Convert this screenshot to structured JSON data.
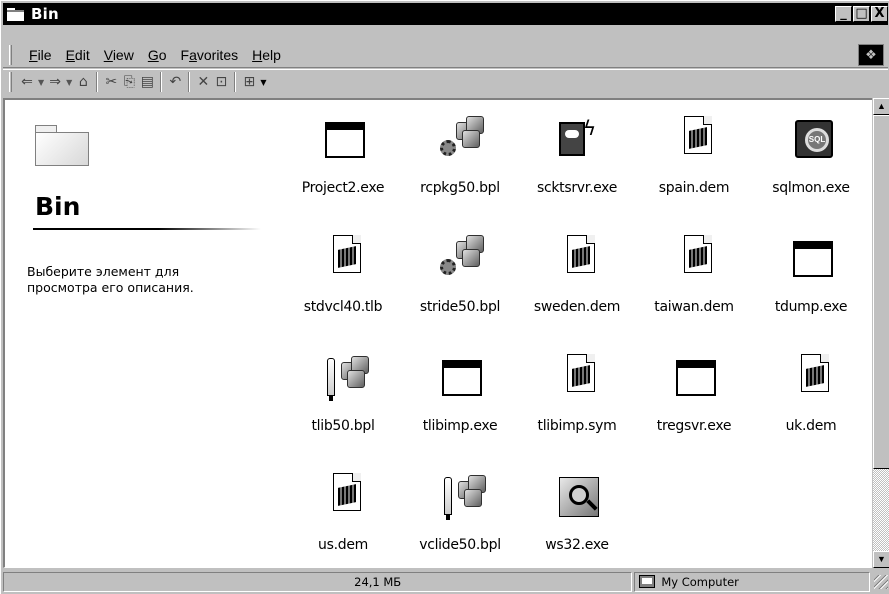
{
  "window": {
    "title": "Bin",
    "controls": {
      "minimize": "_",
      "maximize": "□",
      "close": "X"
    }
  },
  "menu": {
    "items": [
      {
        "key": "F",
        "rest": "ile"
      },
      {
        "key": "E",
        "rest": "dit"
      },
      {
        "key": "V",
        "rest": "iew"
      },
      {
        "key": "G",
        "rest": "o"
      },
      {
        "pre": "F",
        "key": "a",
        "rest": "vorites"
      },
      {
        "key": "H",
        "rest": "elp"
      }
    ]
  },
  "toolbar": {
    "buttons": [
      "back-arrow",
      "dropdown",
      "forward-arrow",
      "dropdown",
      "up-folder",
      "cut",
      "copy",
      "paste",
      "undo",
      "delete",
      "properties",
      "views",
      "dropdown"
    ]
  },
  "left_pane": {
    "title": "Bin",
    "description": "Выберите элемент для просмотра его описания."
  },
  "files": [
    {
      "name": "Project2.exe",
      "icon": "exe-window-icon"
    },
    {
      "name": "rcpkg50.bpl",
      "icon": "package-icon"
    },
    {
      "name": "scktsrvr.exe",
      "icon": "socket-server-icon"
    },
    {
      "name": "spain.dem",
      "icon": "document-icon"
    },
    {
      "name": "sqlmon.exe",
      "icon": "sql-monitor-icon"
    },
    {
      "name": "stdvcl40.tlb",
      "icon": "document-icon"
    },
    {
      "name": "stride50.bpl",
      "icon": "package-icon"
    },
    {
      "name": "sweden.dem",
      "icon": "document-icon"
    },
    {
      "name": "taiwan.dem",
      "icon": "document-icon"
    },
    {
      "name": "tdump.exe",
      "icon": "exe-window-icon"
    },
    {
      "name": "tlib50.bpl",
      "icon": "tlib-package-icon"
    },
    {
      "name": "tlibimp.exe",
      "icon": "exe-window-icon"
    },
    {
      "name": "tlibimp.sym",
      "icon": "document-icon"
    },
    {
      "name": "tregsvr.exe",
      "icon": "exe-window-icon"
    },
    {
      "name": "uk.dem",
      "icon": "document-icon"
    },
    {
      "name": "us.dem",
      "icon": "document-icon"
    },
    {
      "name": "vclide50.bpl",
      "icon": "tlib-package-icon"
    },
    {
      "name": "ws32.exe",
      "icon": "ws32-icon"
    }
  ],
  "status": {
    "size": "24,1 МБ",
    "zone": "My Computer"
  }
}
